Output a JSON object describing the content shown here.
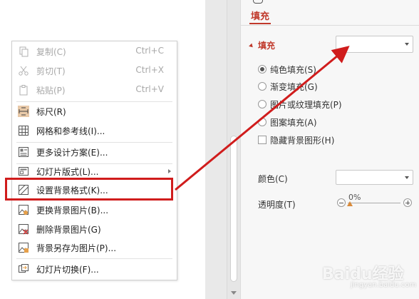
{
  "panel": {
    "tab_label": "填充",
    "section_title": "填充",
    "fill_dropdown_value": "",
    "fill_options": [
      {
        "label": "纯色填充(S)",
        "checked": true
      },
      {
        "label": "渐变填充(G)",
        "checked": false
      },
      {
        "label": "图片或纹理填充(P)",
        "checked": false
      },
      {
        "label": "图案填充(A)",
        "checked": false
      }
    ],
    "hide_bg_label": "隐藏背景图形(H)",
    "color_label": "颜色(C)",
    "color_dropdown_value": "",
    "transparency_label": "透明度(T)",
    "transparency_value": "0%"
  },
  "menu": {
    "items": [
      {
        "label": "复制(C)",
        "shortcut": "Ctrl+C",
        "disabled": true,
        "icon": "copy-icon"
      },
      {
        "label": "剪切(T)",
        "shortcut": "Ctrl+X",
        "disabled": true,
        "icon": "scissors-icon"
      },
      {
        "label": "粘贴(P)",
        "shortcut": "Ctrl+V",
        "disabled": true,
        "icon": "paste-icon"
      },
      {
        "label": "标尺(R)",
        "shortcut": "",
        "disabled": false,
        "icon": "ruler-icon"
      },
      {
        "label": "网格和参考线(I)...",
        "shortcut": "",
        "disabled": false,
        "icon": "grid-icon"
      },
      {
        "label": "更多设计方案(E)...",
        "shortcut": "",
        "disabled": false,
        "icon": "design-icon"
      },
      {
        "label": "幻灯片版式(L)...",
        "shortcut": "",
        "disabled": false,
        "icon": "layout-icon",
        "submenu": true
      },
      {
        "label": "设置背景格式(K)...",
        "shortcut": "",
        "disabled": false,
        "icon": "background-format-icon"
      },
      {
        "label": "更换背景图片(B)...",
        "shortcut": "",
        "disabled": false,
        "icon": "change-bg-image-icon"
      },
      {
        "label": "删除背景图片(G)",
        "shortcut": "",
        "disabled": false,
        "icon": "delete-bg-image-icon"
      },
      {
        "label": "背景另存为图片(P)...",
        "shortcut": "",
        "disabled": false,
        "icon": "save-bg-image-icon"
      },
      {
        "label": "幻灯片切换(F)...",
        "shortcut": "",
        "disabled": false,
        "icon": "transition-icon"
      }
    ]
  },
  "watermark": {
    "text": "Baidu经验",
    "sub": "jingyan.baidu.com"
  },
  "colors": {
    "accent": "#c0392b",
    "highlight": "#d01c1c",
    "arrow": "#d01c1c"
  }
}
